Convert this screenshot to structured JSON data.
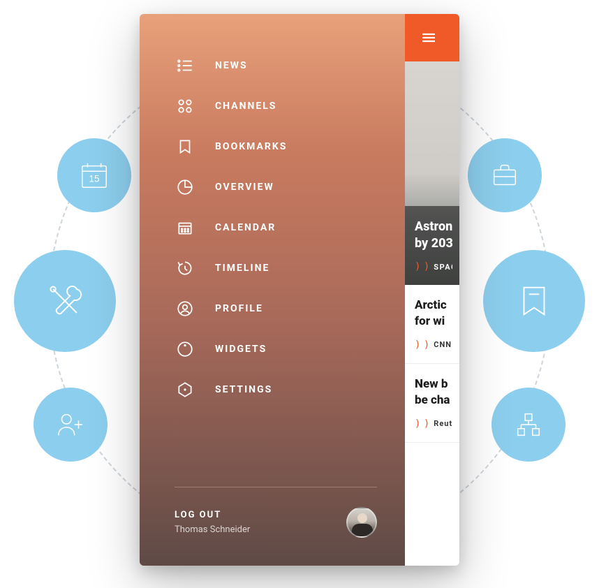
{
  "feature_bubbles": {
    "calendar_day": "15"
  },
  "drawer": {
    "items": [
      {
        "label": "NEWS",
        "icon": "list-icon"
      },
      {
        "label": "CHANNELS",
        "icon": "grid-dots-icon"
      },
      {
        "label": "BOOKMARKS",
        "icon": "bookmark-icon"
      },
      {
        "label": "OVERVIEW",
        "icon": "pie-chart-icon"
      },
      {
        "label": "CALENDAR",
        "icon": "calendar-icon"
      },
      {
        "label": "TIMELINE",
        "icon": "clock-refresh-icon"
      },
      {
        "label": "PROFILE",
        "icon": "user-circle-icon"
      },
      {
        "label": "WIDGETS",
        "icon": "gauge-icon"
      },
      {
        "label": "SETTINGS",
        "icon": "hexagon-icon"
      }
    ],
    "logout_label": "LOG OUT",
    "user_name": "Thomas Schneider"
  },
  "peek": {
    "hero": {
      "title_line1": "Astron",
      "title_line2": "by 203",
      "source": "SPACE"
    },
    "articles": [
      {
        "title_line1": "Arctic",
        "title_line2": "for wi",
        "source": "CNN"
      },
      {
        "title_line1": "New b",
        "title_line2": "be cha",
        "source": "Reute"
      }
    ]
  }
}
